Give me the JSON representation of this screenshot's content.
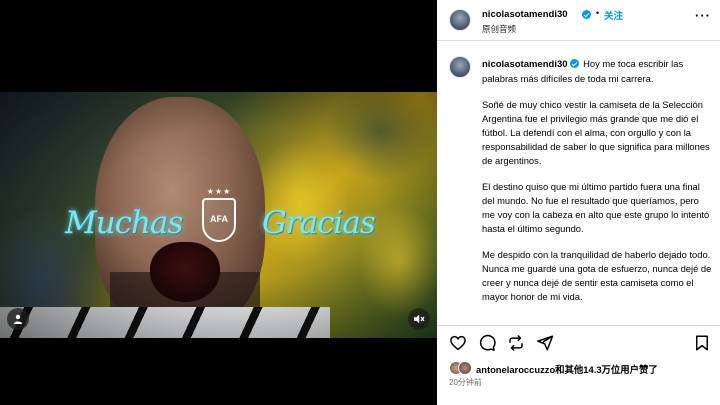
{
  "post": {
    "author": "nicolasotamendi30",
    "follow_label": "关注",
    "separator": "•",
    "audio_label": "原创音频",
    "more_label": "···"
  },
  "video": {
    "overlay_left": "Muchas",
    "overlay_right": "Gracias",
    "badge_stars": "★★★",
    "badge_text": "AFA",
    "mute_icon": "speaker-muted-icon",
    "tag_icon": "user-tag-icon"
  },
  "caption": {
    "paragraphs": [
      "Hoy me toca escribir las palabras más difíciles de toda mi carrera.",
      "Soñé de muy chico vestir la camiseta de la Selección Argentina fue el privilegio más grande que me dió el fútbol. La defendí con el alma, con orgullo y con la responsabilidad de saber lo que significa para millones de argentinos.",
      "El destino quiso que mi último partido fuera una final del mundo. No fue el resultado que queríamos, pero me voy con la cabeza en alto que este grupo lo intentó hasta el último segundo.",
      "Me despido con la tranquilidad de haberlo dejado todo. Nunca me guardé una gota de esfuerzo, nunca dejé de creer y nunca dejé de sentir esta camiseta como el mayor honor de mi vida."
    ]
  },
  "actions": {
    "icons": [
      "heart-icon",
      "comment-icon",
      "repost-icon",
      "share-icon",
      "bookmark-icon"
    ]
  },
  "likes": {
    "text": "antonelaroccuzzo和其他14.3万位用户赞了"
  },
  "timestamp": "20分钟前",
  "colors": {
    "accent": "#0095f6",
    "overlay_text": "#7fe6f0"
  }
}
